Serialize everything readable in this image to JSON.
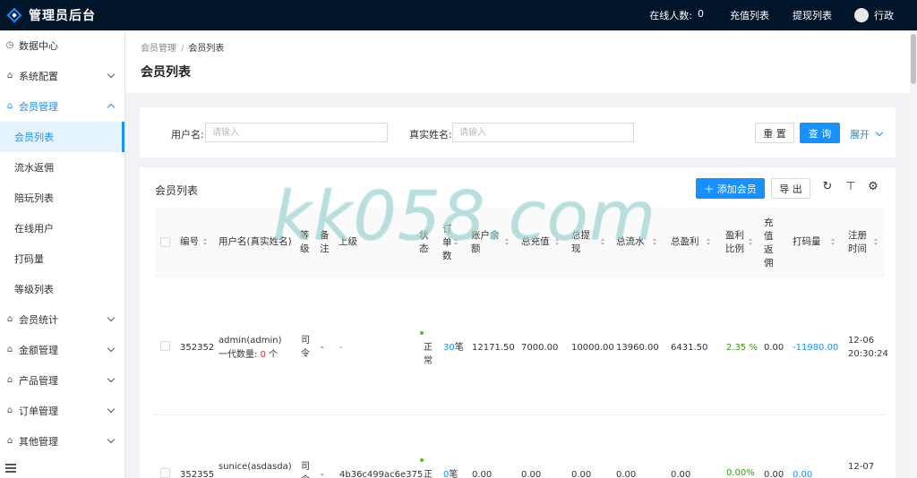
{
  "header": {
    "logo_text": "管理员后台",
    "online_label": "在线人数:",
    "online_count": "0",
    "recharge_list": "充值列表",
    "withdraw_list": "提现列表",
    "username": "行政"
  },
  "sidebar": {
    "items": [
      {
        "label": "数据中心"
      },
      {
        "label": "系统配置"
      },
      {
        "label": "会员管理"
      },
      {
        "label": "会员统计"
      },
      {
        "label": "金额管理"
      },
      {
        "label": "产品管理"
      },
      {
        "label": "订单管理"
      },
      {
        "label": "其他管理"
      }
    ],
    "subitems": [
      "会员列表",
      "流水返佣",
      "陪玩列表",
      "在线用户",
      "打码量",
      "等级列表"
    ]
  },
  "breadcrumb": {
    "parent": "会员管理",
    "sep": "/",
    "current": "会员列表"
  },
  "page_title": "会员列表",
  "search": {
    "username_label": "用户名:",
    "username_placeholder": "请输入",
    "realname_label": "真实姓名:",
    "realname_placeholder": "请输入",
    "reset": "重 置",
    "query": "查 询",
    "expand": "展开"
  },
  "table": {
    "title": "会员列表",
    "add_button": "＋ 添加会员",
    "export_button": "导 出",
    "columns": {
      "id": "编号",
      "username": "用户名(真实姓名)",
      "level": [
        "等",
        "级"
      ],
      "remark": [
        "备",
        "注"
      ],
      "parent": "上级",
      "status": [
        "状",
        "态"
      ],
      "orders": [
        "订",
        "单",
        "数"
      ],
      "balance": [
        "账户余",
        "额"
      ],
      "total_recharge": "总充值",
      "total_withdraw": [
        "总提",
        "现"
      ],
      "total_flow": "总流水",
      "total_profit": "总盈利",
      "profit_ratio": [
        "盈利",
        "比例"
      ],
      "recharge_rebate": [
        "充",
        "值",
        "返",
        "佣"
      ],
      "bet_amount": "打码量",
      "register_time": [
        "注册",
        "时间"
      ]
    },
    "rows": [
      {
        "id": "352352",
        "username": "admin(admin)",
        "first_gen_label": "一代数量:",
        "first_gen_count": "0",
        "first_gen_unit": "个",
        "level": [
          "司",
          "令"
        ],
        "remark": "-",
        "parent": "-",
        "status": [
          "正",
          "常"
        ],
        "orders": "30",
        "orders_unit": "笔",
        "balance": "12171.50",
        "total_recharge": "7000.00",
        "total_withdraw": "10000.00",
        "total_flow": "13960.00",
        "total_profit": "6431.50",
        "profit_ratio": "2.35 %",
        "recharge_rebate": "0.00",
        "bet_amount": "-11980.00",
        "register_time": [
          "12-06",
          "20:30:24"
        ]
      },
      {
        "id": "352355",
        "username": "sunice(asdasda)",
        "level": [
          "司",
          "令"
        ],
        "remark": "-",
        "parent": "4b36c499ac6e375",
        "status": [
          "正"
        ],
        "orders": "0",
        "orders_unit": "笔",
        "balance": "0.00",
        "total_recharge": "0.00",
        "total_withdraw": "0.00",
        "total_flow": "0.00",
        "total_profit": "0.00",
        "profit_ratio": "0.00%",
        "recharge_rebate": "0.00",
        "bet_amount": "0.00",
        "register_time": [
          "12-07"
        ]
      }
    ]
  },
  "watermark": "kk058.com",
  "colors": {
    "topbar": "#001529",
    "primary": "#1890ff",
    "danger": "#f5222d",
    "success": "#389e0d"
  }
}
